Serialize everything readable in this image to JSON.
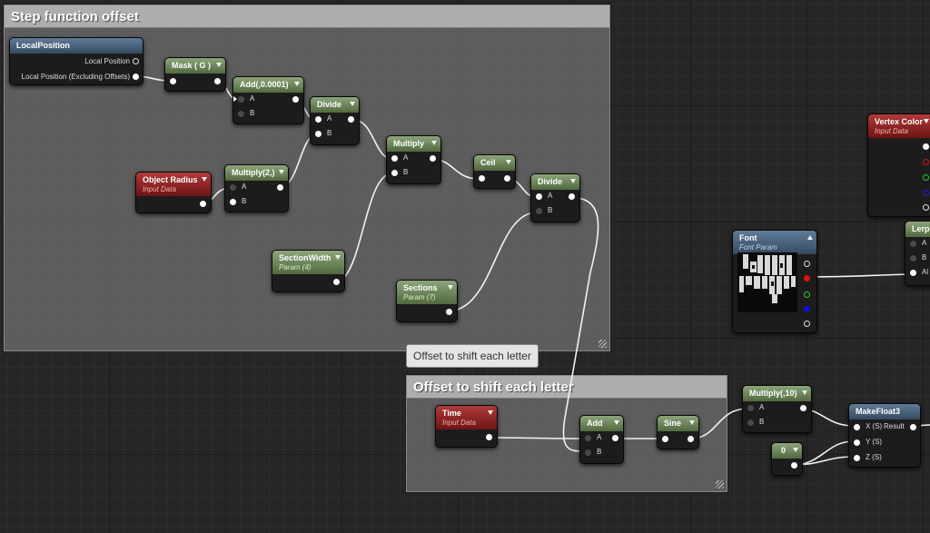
{
  "comments": {
    "step": "Step function offset",
    "offset": "Offset to shift each letter",
    "offset_bubble": "Offset to shift each letter"
  },
  "nodes": {
    "local_position": {
      "title": "LocalPosition",
      "out1": "Local Position",
      "out2": "Local Position (Excluding Offsets)"
    },
    "mask": {
      "title": "Mask ( G )"
    },
    "add1": {
      "title": "Add(,0.0001)",
      "a": "A",
      "b": "B"
    },
    "divide1": {
      "title": "Divide",
      "a": "A",
      "b": "B"
    },
    "object_radius": {
      "title": "Object Radius",
      "sub": "Input Data"
    },
    "multiply1": {
      "title": "Multiply(2,)",
      "a": "A",
      "b": "B"
    },
    "multiply2": {
      "title": "Multiply",
      "a": "A",
      "b": "B"
    },
    "ceil": {
      "title": "Ceil"
    },
    "divide2": {
      "title": "Divide",
      "a": "A",
      "b": "B"
    },
    "section_width": {
      "title": "SectionWidth",
      "sub": "Param (4)"
    },
    "sections": {
      "title": "Sections",
      "sub": "Param (7)"
    },
    "vertex_color": {
      "title": "Vertex Color",
      "sub": "Input Data"
    },
    "lerp": {
      "title": "Lerp",
      "a": "A",
      "b": "B",
      "alpha": "Al"
    },
    "font": {
      "title": "Font",
      "sub": "Font Param"
    },
    "time": {
      "title": "Time",
      "sub": "Input Data"
    },
    "add2": {
      "title": "Add",
      "a": "A",
      "b": "B"
    },
    "sine": {
      "title": "Sine"
    },
    "multiply3": {
      "title": "Multiply(,10)",
      "a": "A",
      "b": "B"
    },
    "constant": {
      "title": "0"
    },
    "makefloat3": {
      "title": "MakeFloat3",
      "x": "X (S)",
      "y": "Y (S)",
      "z": "Z (S)",
      "result": "Result"
    }
  }
}
